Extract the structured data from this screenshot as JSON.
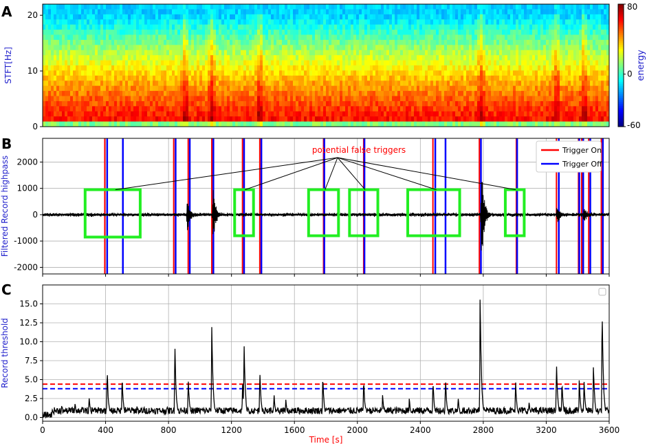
{
  "panels": {
    "a": {
      "letter": "A"
    },
    "b": {
      "letter": "B"
    },
    "c": {
      "letter": "C"
    }
  },
  "chart_data": [
    {
      "type": "heatmap",
      "panel": "A",
      "ylabel": "STFT[Hz]",
      "ylim": [
        0,
        22
      ],
      "yticks": [
        0,
        10,
        20
      ],
      "xlim": [
        0,
        3600
      ],
      "colorbar": {
        "label": "energy",
        "ticks": [
          80,
          0,
          -60
        ],
        "range": [
          -60,
          80
        ],
        "colormap": "jet"
      },
      "energy_bursts_time_s": [
        905,
        1075,
        1380,
        2785,
        3265,
        3440
      ]
    },
    {
      "type": "line",
      "panel": "B",
      "ylabel": "Filtered Record highpass",
      "ylim": [
        -2250,
        2900
      ],
      "yticks": [
        -2000,
        -1000,
        0,
        1000,
        2000
      ],
      "xlim": [
        0,
        3600
      ],
      "grid": true,
      "legend": {
        "placement": "top-right",
        "entries": [
          {
            "name": "Trigger On",
            "color": "#ff0000"
          },
          {
            "name": "Trigger Off",
            "color": "#0000ff"
          }
        ]
      },
      "annotation": {
        "text": "potential false triggers",
        "color": "#ff0000",
        "target_box_index": [
          0,
          1,
          2,
          3,
          4,
          5
        ]
      },
      "trigger_on_s": [
        395,
        833,
        925,
        1075,
        1270,
        1380,
        1785,
        2040,
        2480,
        2775,
        3010,
        3265,
        3405,
        3425,
        3470,
        3550
      ],
      "trigger_off_s": [
        410,
        510,
        845,
        935,
        1085,
        1280,
        1390,
        1790,
        2045,
        2495,
        2560,
        2785,
        3015,
        3280,
        3410,
        3435,
        3480,
        3560
      ],
      "false_trigger_boxes": [
        {
          "t_start": 270,
          "t_end": 620,
          "v_min": -850,
          "v_max": 950
        },
        {
          "t_start": 1220,
          "t_end": 1340,
          "v_min": -800,
          "v_max": 950
        },
        {
          "t_start": 1690,
          "t_end": 1880,
          "v_min": -800,
          "v_max": 950
        },
        {
          "t_start": 1950,
          "t_end": 2130,
          "v_min": -800,
          "v_max": 950
        },
        {
          "t_start": 2320,
          "t_end": 2650,
          "v_min": -800,
          "v_max": 950
        },
        {
          "t_start": 2940,
          "t_end": 3060,
          "v_min": -800,
          "v_max": 950
        }
      ],
      "bursts": [
        {
          "t": 920,
          "amp": 550
        },
        {
          "t": 1085,
          "amp": 1100
        },
        {
          "t": 2790,
          "amp": 1900
        },
        {
          "t": 3270,
          "amp": 350
        },
        {
          "t": 3440,
          "amp": 300
        }
      ],
      "noise_amplitude": 60
    },
    {
      "type": "line",
      "panel": "C",
      "ylabel": "Record threshold",
      "xlabel": "Time [s]",
      "ylim": [
        -0.5,
        17.5
      ],
      "yticks": [
        0.0,
        2.5,
        5.0,
        7.5,
        10.0,
        12.5,
        15.0
      ],
      "xlim": [
        0,
        3600
      ],
      "xticks": [
        0,
        400,
        800,
        1200,
        1600,
        2000,
        2400,
        2800,
        3200,
        3600
      ],
      "grid": true,
      "threshold_on": {
        "value": 4.4,
        "color": "#ff0000",
        "style": "dashed"
      },
      "threshold_off": {
        "value": 3.8,
        "color": "#0000ff",
        "style": "dashed"
      },
      "peaks": [
        {
          "t": 120,
          "v": 1.6
        },
        {
          "t": 205,
          "v": 2.1
        },
        {
          "t": 295,
          "v": 2.9
        },
        {
          "t": 410,
          "v": 6.6
        },
        {
          "t": 505,
          "v": 5.6
        },
        {
          "t": 600,
          "v": 1.8
        },
        {
          "t": 840,
          "v": 10.2
        },
        {
          "t": 925,
          "v": 5.3
        },
        {
          "t": 1075,
          "v": 12.3
        },
        {
          "t": 1270,
          "v": 4.6
        },
        {
          "t": 1280,
          "v": 10.1
        },
        {
          "t": 1380,
          "v": 6.4
        },
        {
          "t": 1470,
          "v": 3.1
        },
        {
          "t": 1545,
          "v": 2.4
        },
        {
          "t": 1780,
          "v": 5.6
        },
        {
          "t": 2040,
          "v": 5.1
        },
        {
          "t": 2160,
          "v": 3.0
        },
        {
          "t": 2330,
          "v": 2.6
        },
        {
          "t": 2480,
          "v": 5.1
        },
        {
          "t": 2560,
          "v": 5.3
        },
        {
          "t": 2640,
          "v": 2.7
        },
        {
          "t": 2780,
          "v": 16.6
        },
        {
          "t": 3005,
          "v": 5.1
        },
        {
          "t": 3090,
          "v": 2.2
        },
        {
          "t": 3265,
          "v": 7.5
        },
        {
          "t": 3300,
          "v": 4.8
        },
        {
          "t": 3410,
          "v": 5.2
        },
        {
          "t": 3440,
          "v": 5.1
        },
        {
          "t": 3500,
          "v": 7.2
        },
        {
          "t": 3555,
          "v": 14.8
        }
      ],
      "baseline": 0.9
    }
  ]
}
